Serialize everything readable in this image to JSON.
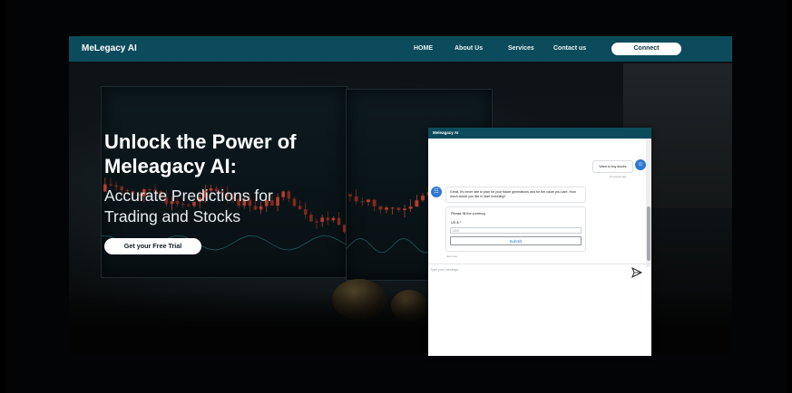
{
  "nav": {
    "brand": "MeLegacy AI",
    "links": [
      "HOME",
      "About Us",
      "Services",
      "Contact us"
    ],
    "connect": "Connect"
  },
  "hero": {
    "headline_line1": "Unlock the Power of",
    "headline_line2": "Meleagacy AI:",
    "subhead_line1": "Accurate Predictions for",
    "subhead_line2": "Trading and Stocks",
    "cta": "Get your Free Trial"
  },
  "chat": {
    "header": "Meleagacy AI",
    "user_message": "Want to buy stocks",
    "user_time": "8 minutes ago",
    "bot_message": "Great, it's never late to plan for your future generations and for the value you care. How much would you like to start investing?",
    "form_title": "Please fill the currency",
    "field_label": "US $ *",
    "field_placeholder": "5000",
    "submit": "Submit",
    "form_time": "Just now",
    "input_placeholder": "Type your message",
    "send_icon": "send-icon",
    "user_icon": "user-avatar-icon",
    "bot_icon": "bot-avatar-icon"
  },
  "colors": {
    "nav_bg": "#0c4b5c",
    "accent_blue": "#2f78d2",
    "candle_red": "#c8422f"
  }
}
